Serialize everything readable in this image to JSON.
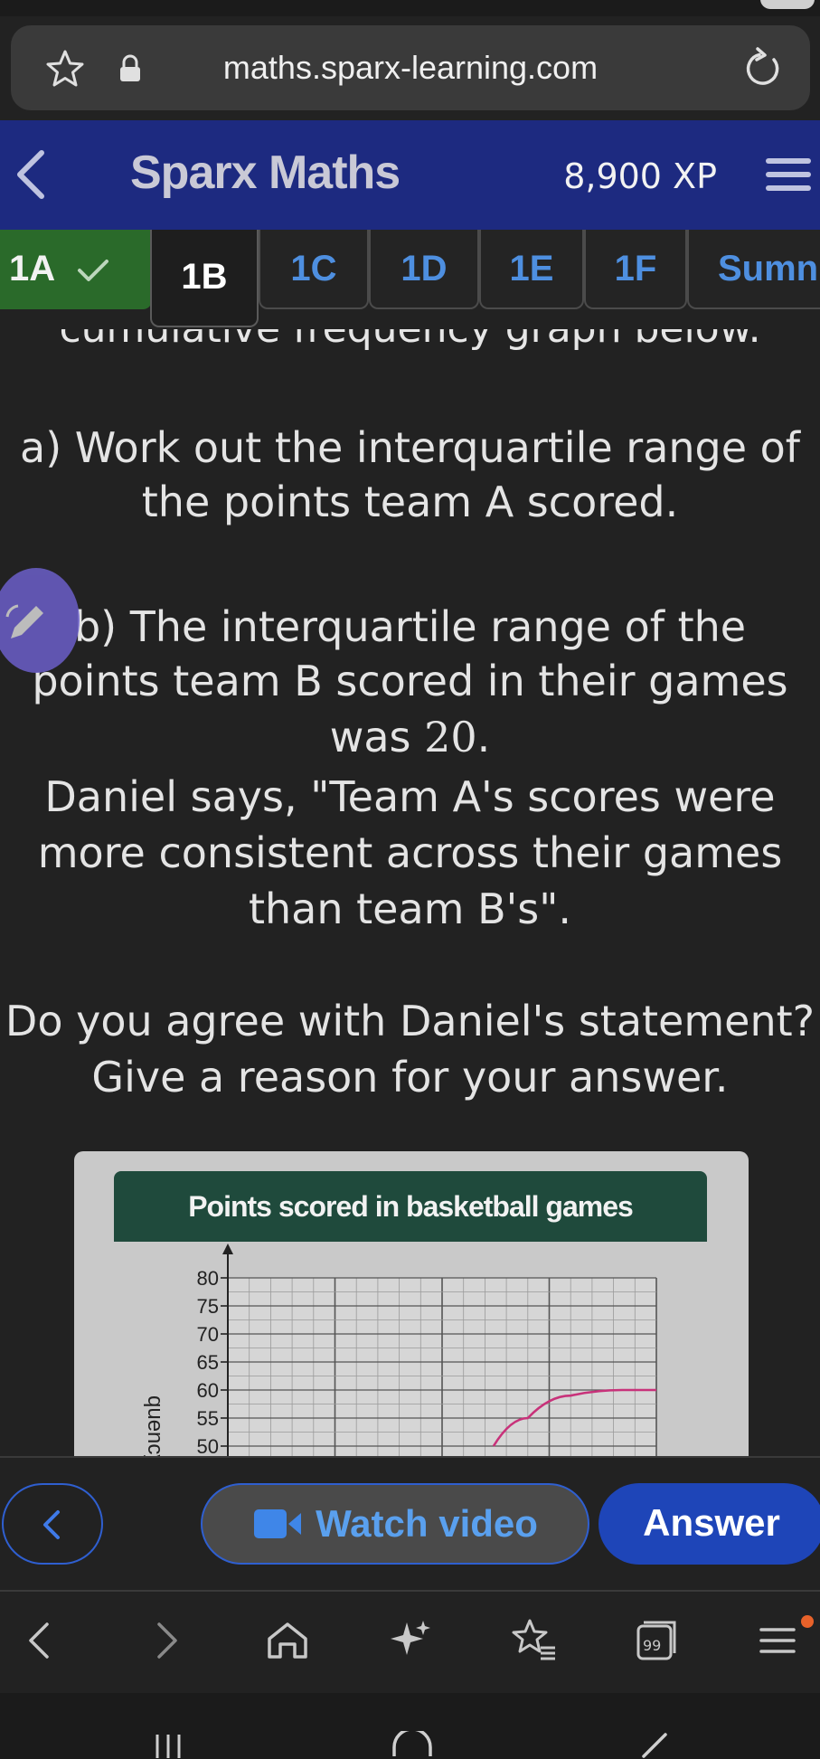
{
  "browser": {
    "url": "maths.sparx-learning.com",
    "icons": [
      "star-icon",
      "lock-icon",
      "reload-icon"
    ]
  },
  "header": {
    "title": "Sparx Maths",
    "xp": "8,900 XP"
  },
  "tabs": [
    {
      "label": "1A",
      "state": "complete"
    },
    {
      "label": "1B",
      "state": "active"
    },
    {
      "label": "1C",
      "state": "default"
    },
    {
      "label": "1D",
      "state": "default"
    },
    {
      "label": "1E",
      "state": "default"
    },
    {
      "label": "1F",
      "state": "default"
    },
    {
      "label": "Sumn",
      "state": "default"
    }
  ],
  "question": {
    "cut_line": "cumulative frequency graph below.",
    "part_a_line1": "a) Work out the interquartile range of",
    "part_a_line2": "the points team A scored.",
    "part_b_line1": "b) The interquartile range of the",
    "part_b_line2": "points team B scored in their games",
    "part_b_line3_pre": "was ",
    "part_b_value": "20",
    "part_b_line3_post": ".",
    "quote_line1": "Daniel says, \"Team A's scores were",
    "quote_line2": "more consistent across their games",
    "quote_line3": "than team B's\".",
    "prompt_line1": "Do you agree with Daniel's statement?",
    "prompt_line2": "Give a reason for your answer."
  },
  "figure": {
    "title": "Points scored in basketball games",
    "ylabel": "quency",
    "colors": {
      "curve": "#c8327a",
      "header": "#1f4a3c"
    }
  },
  "chart_data": {
    "type": "line",
    "title": "Points scored in basketball games",
    "ylabel": "quency",
    "y_ticks": [
      50,
      55,
      60,
      65,
      70,
      75,
      80
    ],
    "ylim": [
      50,
      80
    ],
    "series": [
      {
        "values": [
          [
            3.1,
            50
          ],
          [
            3.5,
            55
          ],
          [
            4.0,
            59
          ],
          [
            4.6,
            60
          ],
          [
            5.0,
            60
          ]
        ]
      }
    ],
    "grid": true
  },
  "actions": {
    "watch_video": "Watch video",
    "answer": "Answer"
  },
  "browser_toolbar": [
    "back-icon",
    "forward-icon",
    "home-icon",
    "ai-sparkle-icon",
    "bookmarks-icon",
    "tabs-icon",
    "menu-icon"
  ],
  "tabs_count": "99"
}
